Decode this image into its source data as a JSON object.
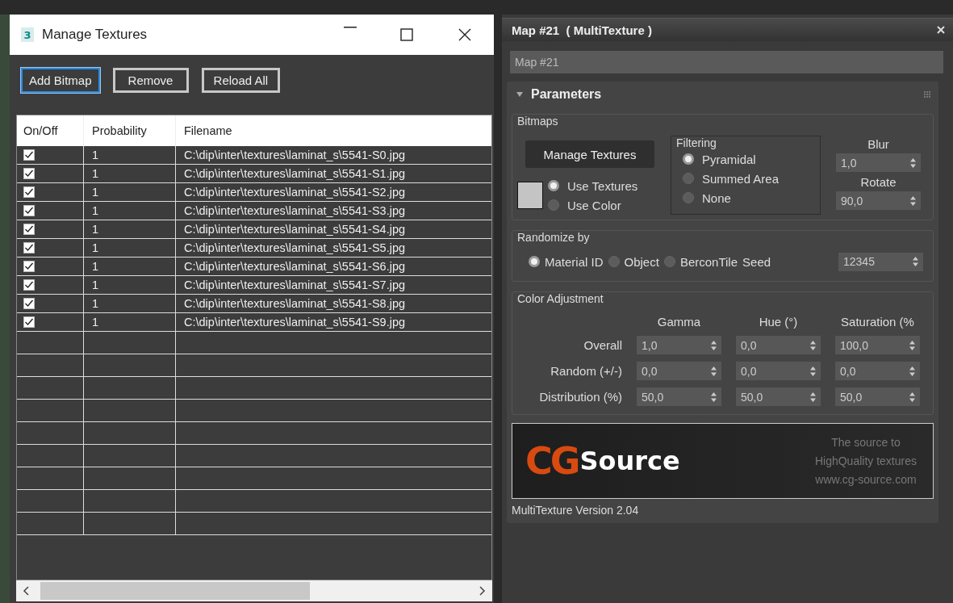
{
  "manage_window": {
    "title": "Manage Textures",
    "app_badge": "3",
    "buttons": [
      {
        "label": "Add Bitmap",
        "focused": true
      },
      {
        "label": "Remove",
        "focused": false
      },
      {
        "label": "Reload All",
        "focused": false
      }
    ],
    "table": {
      "columns": [
        "On/Off",
        "Probability",
        "Filename"
      ],
      "rows": [
        {
          "on": true,
          "probability": "1",
          "filename": "C:\\dip\\inter\\textures\\laminat_s\\5541-S0.jpg"
        },
        {
          "on": true,
          "probability": "1",
          "filename": "C:\\dip\\inter\\textures\\laminat_s\\5541-S1.jpg"
        },
        {
          "on": true,
          "probability": "1",
          "filename": "C:\\dip\\inter\\textures\\laminat_s\\5541-S2.jpg"
        },
        {
          "on": true,
          "probability": "1",
          "filename": "C:\\dip\\inter\\textures\\laminat_s\\5541-S3.jpg"
        },
        {
          "on": true,
          "probability": "1",
          "filename": "C:\\dip\\inter\\textures\\laminat_s\\5541-S4.jpg"
        },
        {
          "on": true,
          "probability": "1",
          "filename": "C:\\dip\\inter\\textures\\laminat_s\\5541-S5.jpg"
        },
        {
          "on": true,
          "probability": "1",
          "filename": "C:\\dip\\inter\\textures\\laminat_s\\5541-S6.jpg"
        },
        {
          "on": true,
          "probability": "1",
          "filename": "C:\\dip\\inter\\textures\\laminat_s\\5541-S7.jpg"
        },
        {
          "on": true,
          "probability": "1",
          "filename": "C:\\dip\\inter\\textures\\laminat_s\\5541-S8.jpg"
        },
        {
          "on": true,
          "probability": "1",
          "filename": "C:\\dip\\inter\\textures\\laminat_s\\5541-S9.jpg"
        }
      ]
    }
  },
  "map_panel": {
    "title": "Map #21  ( MultiTexture )",
    "name_value": "Map #21",
    "rollout": {
      "title": "Parameters",
      "expanded": true,
      "bitmaps": {
        "label": "Bitmaps",
        "manage_button": "Manage Textures",
        "source_options": [
          {
            "label": "Use Textures",
            "selected": true
          },
          {
            "label": "Use Color",
            "selected": false
          }
        ],
        "filtering": {
          "label": "Filtering",
          "options": [
            {
              "label": "Pyramidal",
              "selected": true
            },
            {
              "label": "Summed Area",
              "selected": false
            },
            {
              "label": "None",
              "selected": false
            }
          ]
        },
        "blur": {
          "label": "Blur",
          "value": "1,0"
        },
        "rotate": {
          "label": "Rotate",
          "value": "90,0"
        }
      },
      "randomize": {
        "label": "Randomize by",
        "options": [
          {
            "label": "Material ID",
            "selected": true
          },
          {
            "label": "Object",
            "selected": false
          },
          {
            "label": "BerconTile",
            "selected": false
          }
        ],
        "seed_label": "Seed",
        "seed_value": "12345"
      },
      "color_adjustment": {
        "label": "Color Adjustment",
        "columns": [
          "Gamma",
          "Hue (°)",
          "Saturation (%"
        ],
        "rows": [
          {
            "label": "Overall",
            "values": [
              "1,0",
              "0,0",
              "100,0"
            ]
          },
          {
            "label": "Random (+/-)",
            "values": [
              "0,0",
              "0,0",
              "0,0"
            ]
          },
          {
            "label": "Distribution (%)",
            "values": [
              "50,0",
              "50,0",
              "50,0"
            ]
          }
        ]
      },
      "banner": {
        "logo_mark": "CG",
        "logo_word": "Source",
        "tagline": [
          "The source to",
          "HighQuality textures",
          "www.cg-source.com"
        ]
      },
      "version": "MultiTexture Version 2.04"
    }
  }
}
